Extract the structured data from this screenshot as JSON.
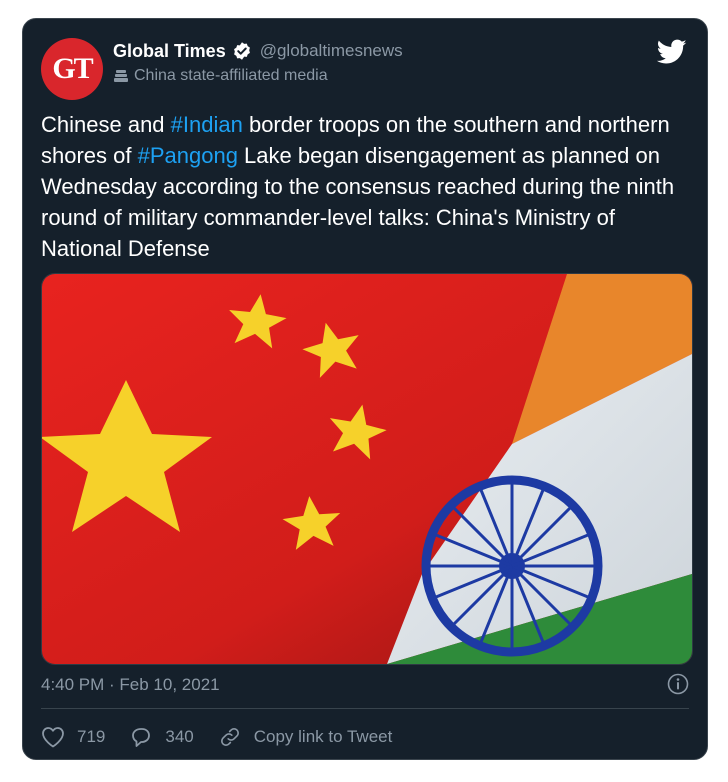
{
  "tweet": {
    "author": {
      "avatar_text": "GT",
      "display_name": "Global Times",
      "handle": "@globaltimesnews",
      "label": "China state-affiliated media",
      "verified": true
    },
    "text_parts": [
      {
        "text": "Chinese and ",
        "type": "plain"
      },
      {
        "text": "#Indian",
        "type": "hashtag"
      },
      {
        "text": " border troops on the southern and northern shores of ",
        "type": "plain"
      },
      {
        "text": "#Pangong",
        "type": "hashtag"
      },
      {
        "text": " Lake began disengagement as planned on Wednesday according to the consensus reached during the ninth round of military commander-level talks: China's Ministry of National Defense",
        "type": "plain"
      }
    ],
    "timestamp": "4:40 PM · Feb 10, 2021",
    "likes": "719",
    "replies": "340",
    "copy_link_label": "Copy link to Tweet"
  },
  "icons": {
    "brand": "twitter-bird-icon",
    "verified": "verified-badge-icon",
    "label": "state-media-flag-icon",
    "info": "info-icon",
    "like": "heart-icon",
    "reply": "reply-bubble-icon",
    "link": "link-icon"
  },
  "colors": {
    "background": "#15202b",
    "hashtag": "#1da1f2",
    "muted": "#8b98a5",
    "avatar": "#d9262c"
  }
}
